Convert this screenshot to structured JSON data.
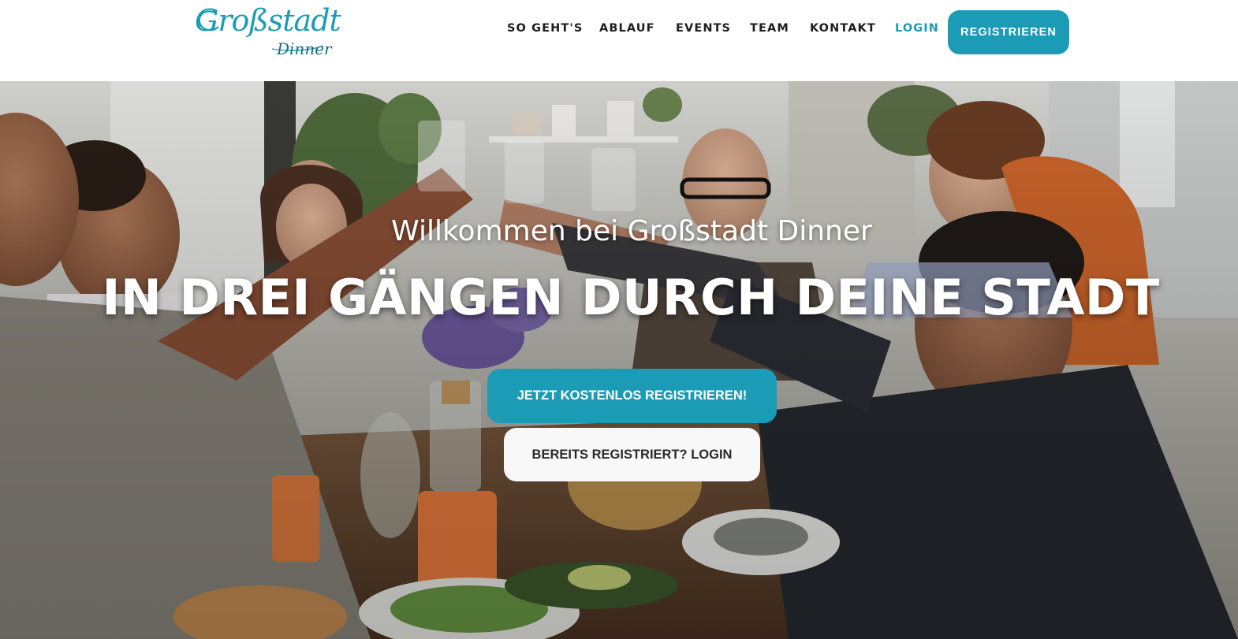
{
  "brand": {
    "logo_main": "Großstadt",
    "logo_sub": "Dinner",
    "color_primary": "#1c9bb6"
  },
  "nav": {
    "items": [
      {
        "label": "SO GEHT'S"
      },
      {
        "label": "ABLAUF"
      },
      {
        "label": "EVENTS"
      },
      {
        "label": "TEAM"
      },
      {
        "label": "KONTAKT"
      }
    ],
    "login_label": "LOGIN",
    "register_label": "REGISTRIEREN"
  },
  "hero": {
    "intro": "Willkommen bei Großstadt Dinner",
    "headline": "IN DREI GÄNGEN DURCH DEINE STADT",
    "cta_primary": "JETZT KOSTENLOS REGISTRIEREN!",
    "cta_secondary": "BEREITS REGISTRIERT? LOGIN"
  }
}
